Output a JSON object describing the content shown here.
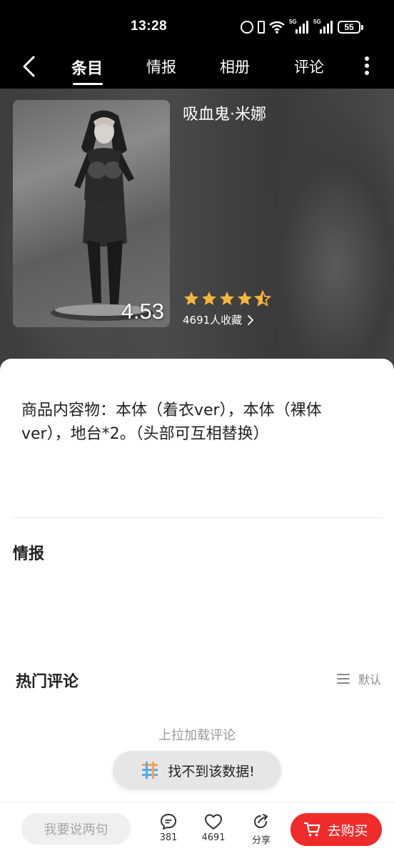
{
  "status_bar": {
    "time": "13:28",
    "signal1_label": "5G",
    "signal2_label": "5G",
    "battery": "55",
    "icons": [
      "alarm-icon",
      "vibrate-icon",
      "wifi-icon",
      "signal-icon",
      "signal-icon",
      "battery-icon"
    ]
  },
  "nav": {
    "tabs": [
      {
        "label": "条目",
        "active": true
      },
      {
        "label": "情报",
        "active": false
      },
      {
        "label": "相册",
        "active": false
      },
      {
        "label": "评论",
        "active": false
      }
    ],
    "icons": [
      "back-arrow-icon",
      "more-vertical-icon"
    ]
  },
  "product": {
    "title": "吸血鬼·米娜",
    "score": "4.53",
    "rating": 4.5,
    "collect_text": "4691人收藏",
    "colors": {
      "star": "#f6b63a"
    }
  },
  "content": {
    "description": "商品内容物：本体（着衣ver），本体（裸体ver），地台*2。（头部可互相替换）",
    "info_heading": "情报",
    "hot_comments_heading": "热门评论",
    "sort_label": "默认",
    "load_more": "上拉加载评论"
  },
  "toast": {
    "text": "找不到该数据!",
    "icon": "app-logo-icon"
  },
  "bottom_bar": {
    "input_placeholder": "我要说两句",
    "comment_count": "381",
    "like_count": "4691",
    "share_label": "分享",
    "buy_label": "去购买",
    "colors": {
      "buy": "#f02b2b"
    }
  }
}
